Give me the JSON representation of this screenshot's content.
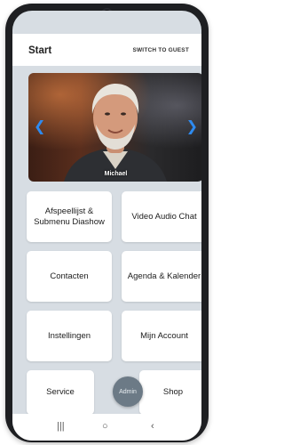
{
  "header": {
    "title": "Start",
    "switch_label": "SWITCH TO GUEST"
  },
  "photo": {
    "person_name": "Michael"
  },
  "tiles": [
    {
      "label": "Afspeellijst & Submenu Diashow"
    },
    {
      "label": "Video Audio Chat"
    },
    {
      "label": "Contacten"
    },
    {
      "label": "Agenda & Kalender"
    },
    {
      "label": "Instellingen"
    },
    {
      "label": "Mijn Account"
    },
    {
      "label": "Service"
    },
    {
      "label": "Shop"
    }
  ],
  "admin_label": "Admin",
  "nav": {
    "recent": "|||",
    "home": "○",
    "back": "‹"
  },
  "colors": {
    "accent": "#2e8bf0",
    "admin_bg": "#6c7a86",
    "screen_bg": "#d7dde3"
  }
}
